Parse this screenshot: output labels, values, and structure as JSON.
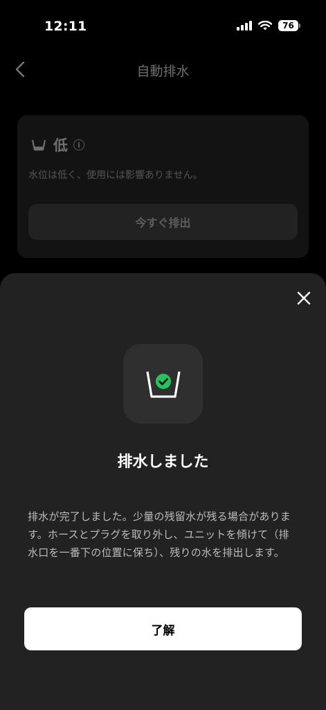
{
  "status_bar": {
    "time": "12:11",
    "battery": "76"
  },
  "nav": {
    "title": "自動排水"
  },
  "water_card": {
    "level": "低",
    "info_symbol": "i",
    "description": "水位は低く、使用には影響ありません。",
    "drain_button": "今すぐ排出"
  },
  "sheet": {
    "title": "排水しました",
    "message": "排水が完了しました。少量の残留水が残る場合があります。ホースとプラグを取り外し、ユニットを傾けて（排水口を一番下の位置に保ち）、残りの水を排出します。",
    "confirm_button": "了解"
  },
  "colors": {
    "success": "#22C55E",
    "sheet_bg": "#222222",
    "page_bg": "#000000"
  },
  "icons": [
    "signal-icon",
    "wifi-icon",
    "battery-icon",
    "back-chevron-icon",
    "bucket-icon",
    "info-icon",
    "close-icon",
    "bucket-check-icon"
  ]
}
